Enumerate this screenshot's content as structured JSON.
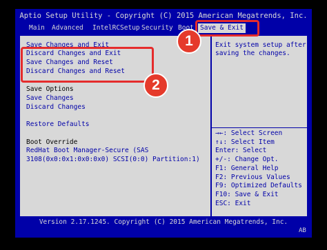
{
  "title": "Aptio Setup Utility - Copyright (C) 2015 American Megatrends, Inc.",
  "menu": {
    "main": "Main",
    "advanced": "Advanced",
    "intelrcsetup": "IntelRCSetup",
    "security": "Security",
    "boot": "Boot",
    "save_exit": "Save & Exit"
  },
  "main_panel": {
    "save_changes_exit": "Save Changes and Exit",
    "discard_changes_exit": "Discard Changes and Exit",
    "save_changes_reset": "Save Changes and Reset",
    "discard_changes_reset": "Discard Changes and Reset",
    "save_options": "Save Options",
    "save_changes": "Save Changes",
    "discard_changes": "Discard Changes",
    "restore_defaults": "Restore Defaults",
    "boot_override": "Boot Override",
    "boot_device_line1": "RedHat Boot Manager-Secure (SAS",
    "boot_device_line2": "3108(0x0:0x1:0x0:0x0) SCSI(0:0) Partition:1)"
  },
  "help": {
    "line1": "Exit system setup after",
    "line2": "saving the changes."
  },
  "keys": [
    "→←: Select Screen",
    "↑↓: Select Item",
    "Enter: Select",
    "+/-: Change Opt.",
    "F1: General Help",
    "F2: Previous Values",
    "F9: Optimized Defaults",
    "F10: Save & Exit",
    "ESC: Exit"
  ],
  "footer": "Version 2.17.1245. Copyright (C) 2015 American Megatrends, Inc.",
  "corner": "AB",
  "callouts": {
    "one": "1",
    "two": "2"
  },
  "colors": {
    "bios_blue": "#0000a8",
    "bios_gray": "#d8d8d8",
    "callout_red": "#e52b2b"
  }
}
